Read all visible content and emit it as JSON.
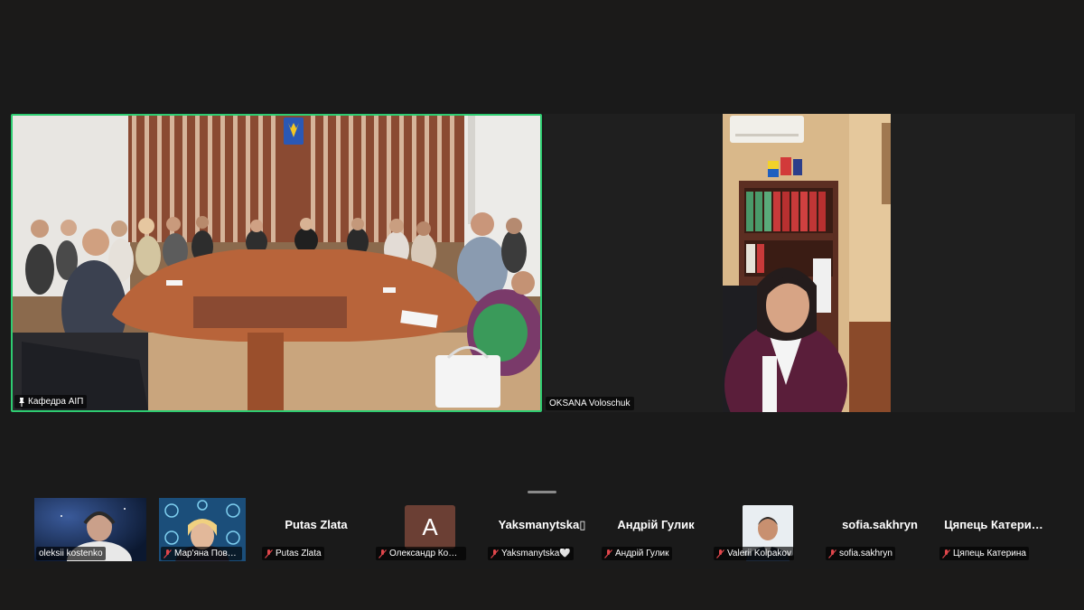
{
  "main_tile": {
    "name": "Кафедра АІП"
  },
  "second_tile": {
    "name": "OKSANA Voloschuk"
  },
  "participants": [
    {
      "label": "oleksii kostenko",
      "type": "video",
      "muted": false
    },
    {
      "label": "Мар'яна Повале…",
      "type": "video",
      "muted": true
    },
    {
      "label": "Putas Zlata",
      "display": "Putas Zlata",
      "type": "name",
      "muted": true
    },
    {
      "label": "Олександр Комі…",
      "avatar_letter": "A",
      "type": "avatar",
      "muted": true
    },
    {
      "label": "Yaksmanytska🤍",
      "display": "Yaksmanytska▯",
      "type": "name",
      "muted": true
    },
    {
      "label": "Андрій Гулик",
      "display": "Андрій Гулик",
      "type": "name",
      "muted": true
    },
    {
      "label": "Valerii Kolpakov",
      "type": "photo",
      "muted": true
    },
    {
      "label": "sofia.sakhryn",
      "display": "sofia.sakhryn",
      "type": "name",
      "muted": true
    },
    {
      "label": "Цяпець Катерина",
      "display": "Цяпець  Катери…",
      "type": "name",
      "muted": true
    }
  ],
  "colors": {
    "active_speaker_border": "#2ecc71",
    "muted_icon": "#e0464b",
    "background": "#1a1a1a"
  }
}
